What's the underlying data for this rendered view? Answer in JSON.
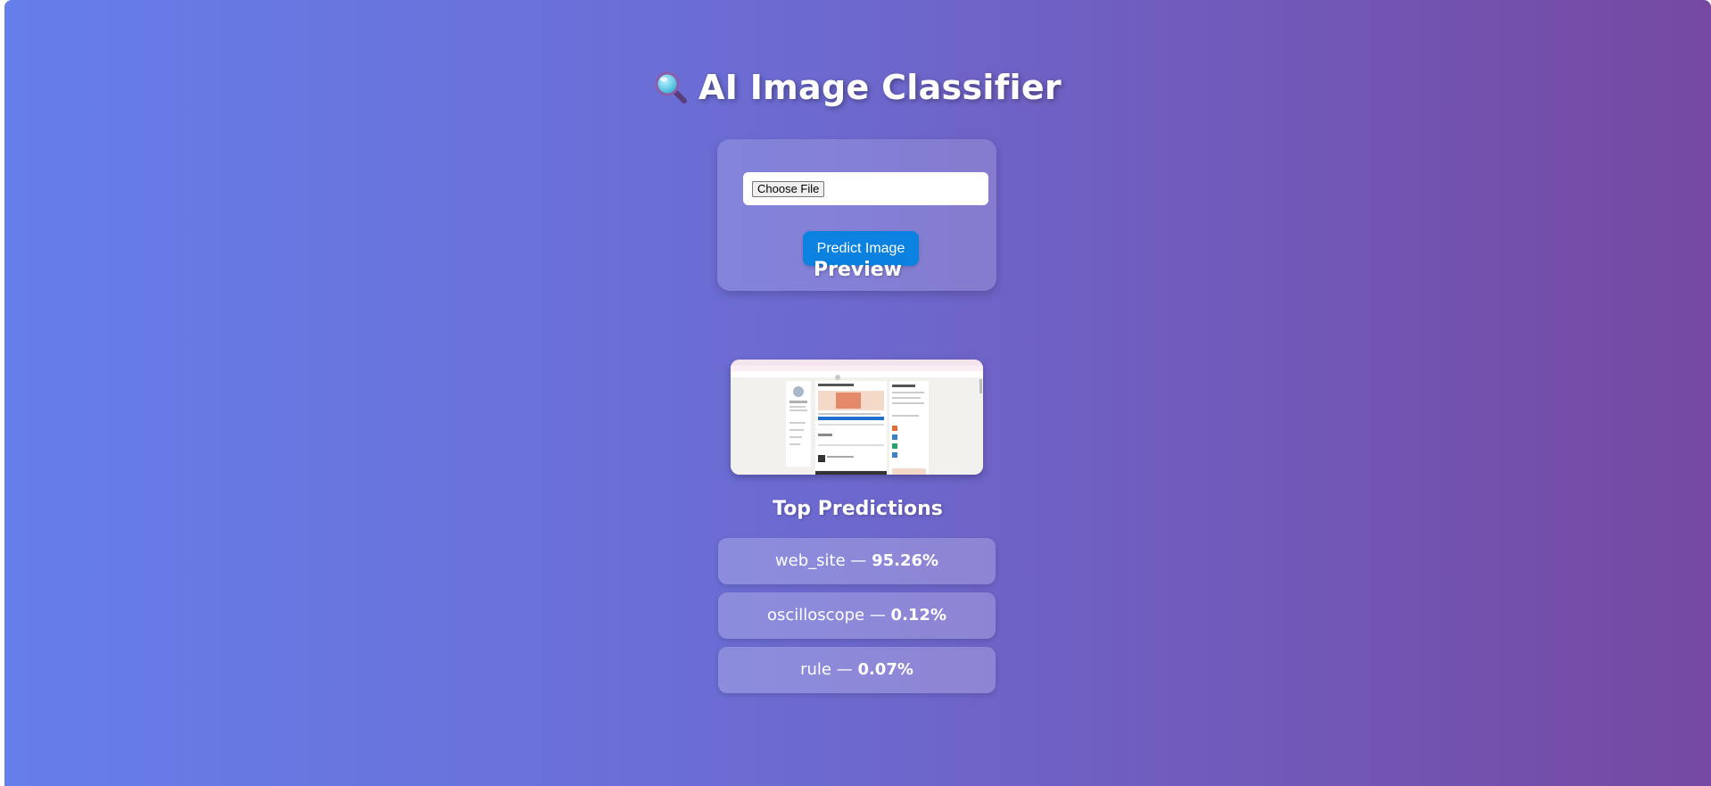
{
  "header": {
    "title": "AI Image Classifier",
    "icon": "magnifying-glass-icon"
  },
  "upload": {
    "choose_file_label": "Choose File",
    "predict_label": "Predict Image"
  },
  "preview": {
    "heading": "Preview"
  },
  "predictions": {
    "heading": "Top Predictions",
    "separator": " — ",
    "items": [
      {
        "label": "web_site",
        "percent": "95.26%"
      },
      {
        "label": "oscilloscope",
        "percent": "0.12%"
      },
      {
        "label": "rule",
        "percent": "0.07%"
      }
    ]
  },
  "colors": {
    "gradient_start": "#667eea",
    "gradient_end": "#764ba2",
    "predict_button": "#0b82e0"
  }
}
